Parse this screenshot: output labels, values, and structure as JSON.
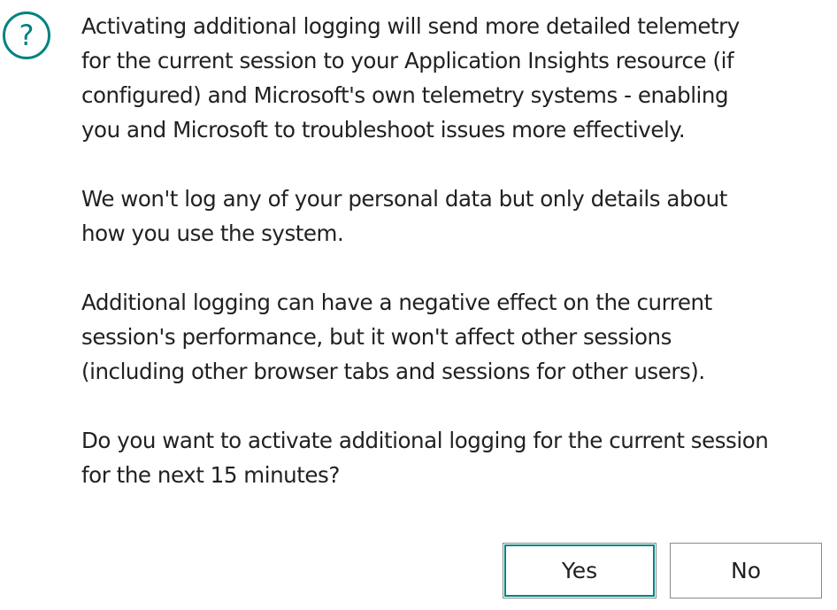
{
  "dialog": {
    "icon": "question-circle-icon",
    "accent_color": "#00827f",
    "paragraphs": [
      "Activating additional logging will send more detailed telemetry\nfor the current session to your Application Insights resource (if\nconfigured) and Microsoft's own telemetry systems - enabling\nyou and Microsoft to troubleshoot issues more effectively.",
      "We won't log any of your personal data but only details about\nhow you use the system.",
      "Additional logging can have a negative effect on the current\nsession's performance, but it won't affect other sessions\n(including other browser tabs and sessions for other users).",
      "Do you want to activate additional logging for the current session\nfor the next 15 minutes?"
    ],
    "buttons": {
      "yes_label": "Yes",
      "no_label": "No"
    }
  }
}
